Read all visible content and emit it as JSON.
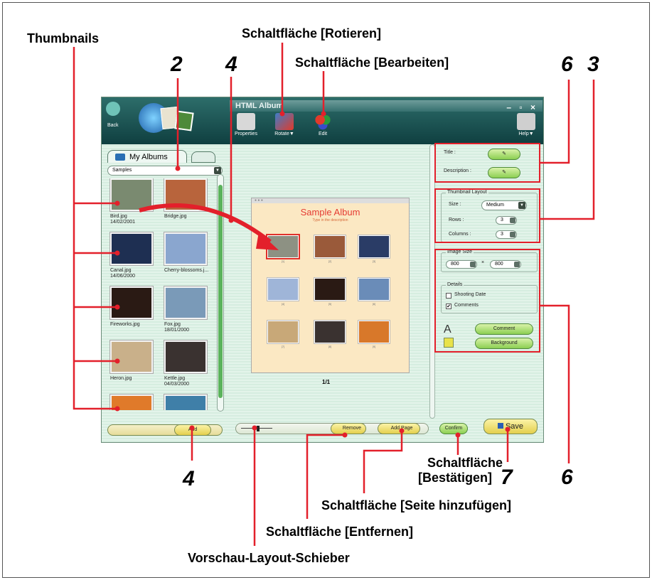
{
  "callouts": {
    "thumbnails": "Thumbnails",
    "rotate_button": "Schaltfläche [Rotieren]",
    "edit_button": "Schaltfläche [Bearbeiten]",
    "confirm_button_line1": "Schaltfläche",
    "confirm_button_line2": "[Bestätigen]",
    "add_page_button": "Schaltfläche [Seite hinzufügen]",
    "remove_button": "Schaltfläche [Entfernen]",
    "preview_layout_slider": "Vorschau-Layout-Schieber"
  },
  "step_numbers": {
    "n2": "2",
    "n4_top": "4",
    "n6_top": "6",
    "n3": "3",
    "n4_bottom": "4",
    "n7": "7",
    "n6_bottom": "6"
  },
  "window": {
    "title": "HTML Album",
    "controls": "– ▫ ×",
    "back_label": "Back",
    "toolbar": {
      "properties": "Properties",
      "rotate": "Rotate▼",
      "edit": "Edit",
      "help": "Help▼"
    }
  },
  "left_panel": {
    "tab_label": "My Albums",
    "album_select": "Samples",
    "thumbnails": [
      {
        "name": "Bird.jpg",
        "date": "14/02/2001",
        "color": "#7a8a70"
      },
      {
        "name": "Bridge.jpg",
        "date": "",
        "color": "#b8643c"
      },
      {
        "name": "Canal.jpg",
        "date": "14/06/2000",
        "color": "#1e2f52"
      },
      {
        "name": "Cherry-blossoms.j...",
        "date": "",
        "color": "#8aa6cf"
      },
      {
        "name": "Fireworks.jpg",
        "date": "",
        "color": "#2a1a14"
      },
      {
        "name": "Fox.jpg",
        "date": "18/01/2000",
        "color": "#7a9ab8"
      },
      {
        "name": "Heron.jpg",
        "date": "",
        "color": "#c9b08a"
      },
      {
        "name": "Kettle.jpg",
        "date": "04/03/2000",
        "color": "#3a3230"
      },
      {
        "name": "",
        "date": "",
        "color": "#e07a2a"
      },
      {
        "name": "",
        "date": "",
        "color": "#3f7fa8"
      }
    ],
    "add_button": "Add"
  },
  "preview": {
    "album_title": "Sample Album",
    "album_description": "Type in the description",
    "photo_captions": [
      "[1]",
      "[2]",
      "[3]",
      "[4]",
      "[5]",
      "[6]",
      "[7]",
      "[8]",
      "[9]"
    ],
    "photo_colors": [
      "#8d9183",
      "#9a5a3a",
      "#2a3c66",
      "#9fb5d8",
      "#2a1a14",
      "#6a8cb8",
      "#c8a878",
      "#3a3230",
      "#d8782a"
    ],
    "page_indicator": "1/1",
    "remove_button": "Remove",
    "add_page_button": "Add Page"
  },
  "settings": {
    "title_label": "Title :",
    "description_label": "Description :",
    "thumbnail_layout_label": "Thumbnail Layout",
    "size_label": "Size :",
    "size_value": "Medium",
    "rows_label": "Rows :",
    "rows_value": "3",
    "columns_label": "Columns :",
    "columns_value": "3",
    "image_size_label": "Image Size",
    "image_width": "800",
    "image_height": "800",
    "times": "×",
    "details_label": "Details",
    "shooting_date_label": "Shooting Date",
    "shooting_date_checked": false,
    "comments_label": "Comments",
    "comments_checked": true,
    "comment_button": "Comment",
    "background_button": "Background",
    "confirm_button": "Confirm",
    "save_button": "Save"
  },
  "accent_colors": {
    "callout_red": "#e3202b",
    "window_teal": "#1f5756"
  }
}
